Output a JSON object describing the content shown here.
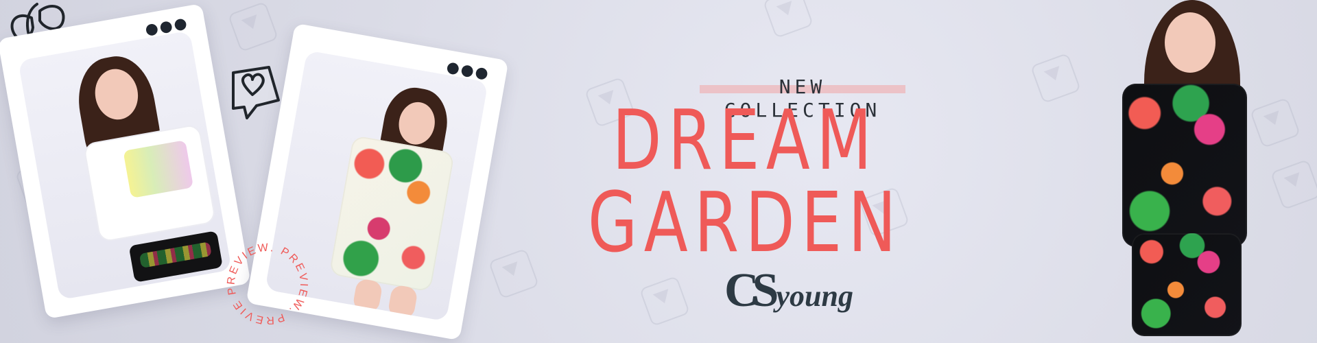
{
  "banner": {
    "kicker": "NEW COLLECTION",
    "headline": "DREAM GARDEN",
    "brand": {
      "mark": "CS",
      "word": "young"
    },
    "preview_badge": "PREVIEW. PREVIEW. PREVIEW."
  },
  "colors": {
    "background": "#dedfe9",
    "headline": "#ef5a58",
    "kicker_text": "#2b3138",
    "kicker_highlight": "#f0afb0",
    "logo": "#2d3a44",
    "polaroid_frame": "#ffffff"
  },
  "icons": {
    "polaroid_menu": "more-dots-icon",
    "heart_bubble": "heart-speech-bubble-icon",
    "plant_doodle": "leaf-doodle-icon"
  }
}
